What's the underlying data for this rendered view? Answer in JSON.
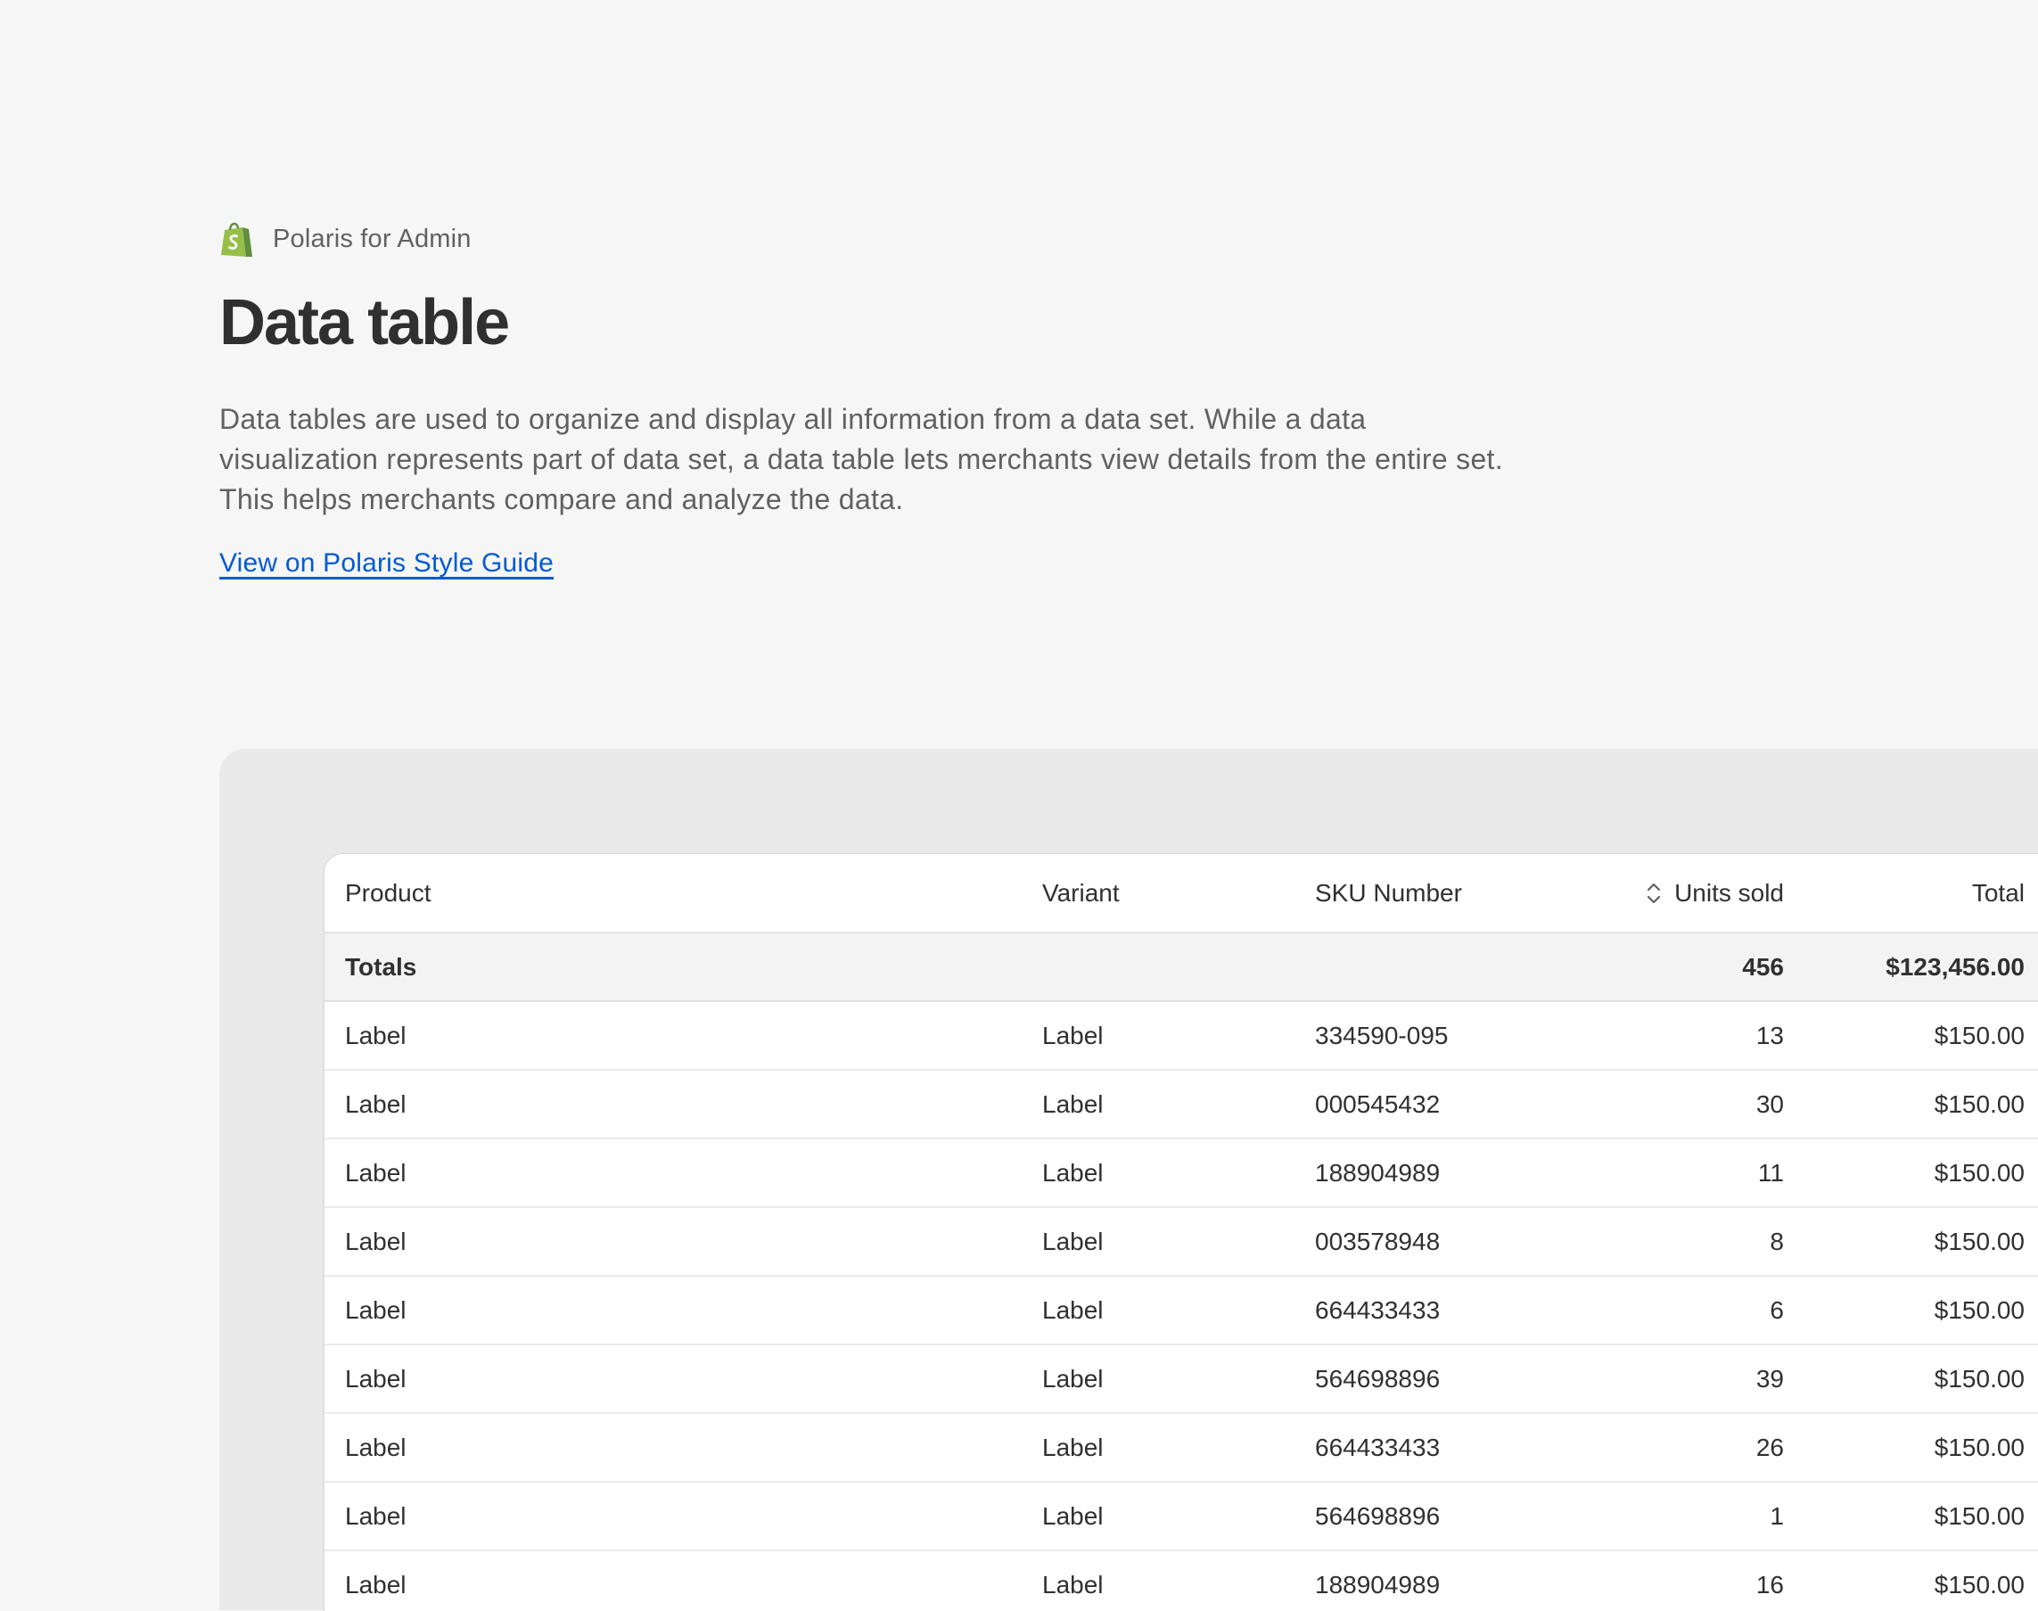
{
  "brand": {
    "name": "Polaris for Admin",
    "logo_icon": "shopify-bag-icon",
    "logo_color": "#95bf47"
  },
  "page": {
    "title": "Data table",
    "description": "Data tables are used to organize and display all information from a data set. While a data visualization represents part of data set, a data table lets merchants view details from the entire set. This helps merchants compare and analyze the data.",
    "link_label": "View on Polaris Style Guide",
    "link_color": "#005bd3"
  },
  "table": {
    "columns": {
      "product": "Product",
      "variant": "Variant",
      "sku": "SKU Number",
      "units": "Units sold",
      "total": "Total"
    },
    "sort_icon": "sort-icon",
    "totals": {
      "label": "Totals",
      "units": "456",
      "total": "$123,456.00"
    },
    "rows": [
      {
        "product": "Label",
        "variant": "Label",
        "sku": "334590-095",
        "units": "13",
        "total": "$150.00"
      },
      {
        "product": "Label",
        "variant": "Label",
        "sku": "000545432",
        "units": "30",
        "total": "$150.00"
      },
      {
        "product": "Label",
        "variant": "Label",
        "sku": "188904989",
        "units": "11",
        "total": "$150.00"
      },
      {
        "product": "Label",
        "variant": "Label",
        "sku": "003578948",
        "units": "8",
        "total": "$150.00"
      },
      {
        "product": "Label",
        "variant": "Label",
        "sku": "664433433",
        "units": "6",
        "total": "$150.00"
      },
      {
        "product": "Label",
        "variant": "Label",
        "sku": "564698896",
        "units": "39",
        "total": "$150.00"
      },
      {
        "product": "Label",
        "variant": "Label",
        "sku": "664433433",
        "units": "26",
        "total": "$150.00"
      },
      {
        "product": "Label",
        "variant": "Label",
        "sku": "564698896",
        "units": "1",
        "total": "$150.00"
      },
      {
        "product": "Label",
        "variant": "Label",
        "sku": "188904989",
        "units": "16",
        "total": "$150.00"
      }
    ]
  }
}
